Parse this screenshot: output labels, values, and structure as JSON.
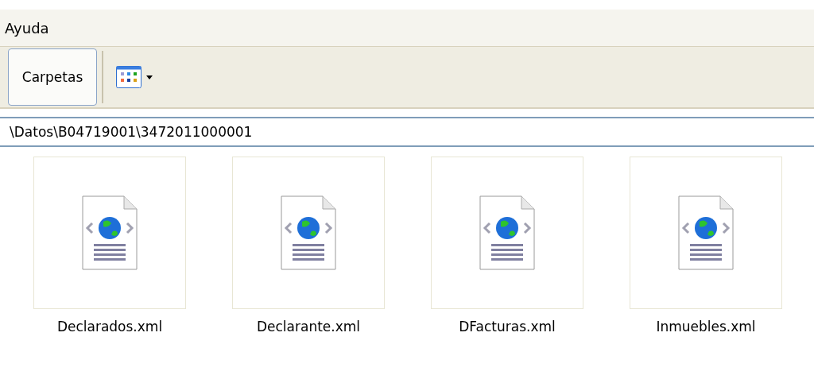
{
  "menu": [
    "Ayuda"
  ],
  "toolbar": {
    "folders_button": "Carpetas"
  },
  "address": {
    "value": "\\Datos\\B04719001\\3472011000001"
  },
  "files": [
    {
      "name": "Declarados.xml",
      "selected": false
    },
    {
      "name": "Declarante.xml",
      "selected": false
    },
    {
      "name": "DFacturas.xml",
      "selected": false
    },
    {
      "name": "Inmuebles.xml",
      "selected": false
    }
  ]
}
